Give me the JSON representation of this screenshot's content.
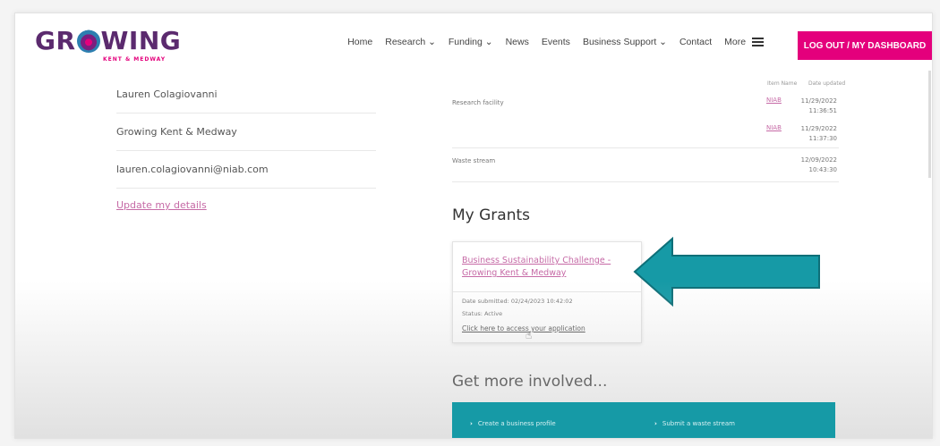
{
  "header": {
    "logo_text": "GROWING",
    "logo_sub": "KENT & MEDWAY",
    "nav": [
      {
        "label": "Home"
      },
      {
        "label": "Research ⌄"
      },
      {
        "label": "Funding ⌄"
      },
      {
        "label": "News"
      },
      {
        "label": "Events"
      },
      {
        "label": "Business Support ⌄"
      },
      {
        "label": "Contact"
      },
      {
        "label": "More"
      }
    ],
    "logout_label": "LOG OUT / MY DASHBOARD"
  },
  "profile": {
    "name": "Lauren Colagiovanni",
    "organisation": "Growing Kent & Medway",
    "email": "lauren.colagiovanni@niab.com",
    "update_link": "Update my details"
  },
  "items_table": {
    "col_item_name": "Item Name",
    "col_date_updated": "Date updated",
    "rows": [
      {
        "label": "Research facility",
        "item": "NIAB",
        "date": "11/29/2022",
        "time": "11:36:51"
      },
      {
        "label": "",
        "item": "NIAB",
        "date": "11/29/2022",
        "time": "11:37:30"
      },
      {
        "label": "Waste stream",
        "item": "",
        "date": "12/09/2022",
        "time": "10:43:30"
      }
    ]
  },
  "grants": {
    "heading": "My Grants",
    "card": {
      "title": "Business Sustainability Challenge - Growing Kent & Medway",
      "date_submitted": "Date submitted: 02/24/2023 10:42:02",
      "status": "Status: Active",
      "access_link": "Click here to access your application"
    }
  },
  "involved": {
    "heading": "Get more involved...",
    "items": [
      {
        "label": "Create a business profile"
      },
      {
        "label": "Submit a waste stream"
      }
    ]
  },
  "colors": {
    "brand_magenta": "#e4007c",
    "brand_purple": "#5b2a6e",
    "arrow_teal": "#169aa6",
    "link_pink": "#c66aa6"
  },
  "icons": [
    "menu-icon",
    "cursor-hand-icon",
    "chevron-right-icon",
    "annotation-arrow-icon"
  ]
}
